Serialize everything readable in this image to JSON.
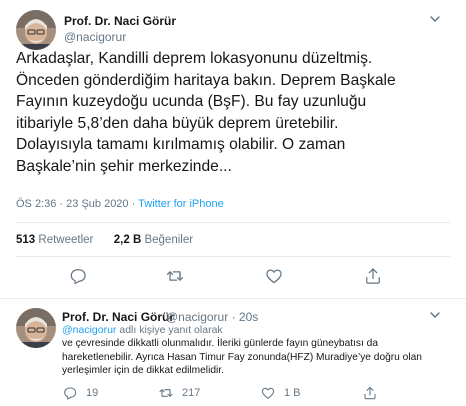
{
  "tweet": {
    "author_name": "Prof. Dr. Naci Görür",
    "author_handle": "@nacigorur",
    "text": "Arkadaşlar, Kandilli deprem lokasyonunu düzeltmiş.\nÖnceden gönderdiğim haritaya bakın. Deprem Başkale\nFayının kuzeydoğu ucunda (BşF). Bu fay uzunluğu\nitibariyle 5,8’den daha büyük deprem üretebilir.\nDolayısıyla tamamı kırılmamış olabilir. O zaman\nBaşkale’nin şehir merkezinde...",
    "time": "ÖS 2:36",
    "date": "23 Şub 2020",
    "separator": "·",
    "source": "Twitter for iPhone",
    "retweets_count": "513",
    "retweets_label": "Retweetler",
    "likes_count": "2,2 B",
    "likes_label": "Beğeniler"
  },
  "reply": {
    "author_name": "Prof. Dr. Naci Görür",
    "author_handle": "@nacigorur",
    "separator": "·",
    "age": "20s",
    "reply_mention": "@nacigorur",
    "reply_suffix": "adlı kişiye yanıt olarak",
    "text": "ve çevresinde dikkatli olunmalıdır. İleriki günlerde fayın güneybatısı da hareketlenebilir. Ayrıca Hasan Timur Fay zonunda(HFZ) Muradiye’ye doğru olan yerleşimler için de dikkat edilmelidir.",
    "reply_count": "19",
    "retweet_count": "217",
    "like_count": "1 B"
  },
  "icons": {
    "reply": "reply-icon",
    "retweet": "retweet-icon",
    "like": "heart-icon",
    "share": "share-icon",
    "caret": "chevron-down-icon"
  },
  "colors": {
    "text": "#14171a",
    "secondary": "#657786",
    "link": "#1da1f2",
    "divider": "#e6ecf0"
  }
}
